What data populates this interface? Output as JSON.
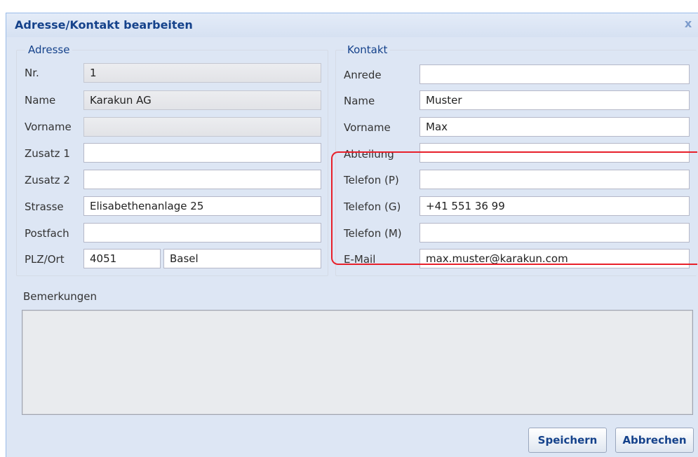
{
  "dialog": {
    "title": "Adresse/Kontakt bearbeiten",
    "close_glyph": "x"
  },
  "adresse": {
    "legend": "Adresse",
    "fields": {
      "nr": {
        "label": "Nr.",
        "value": "1"
      },
      "name": {
        "label": "Name",
        "value": "Karakun AG"
      },
      "vorname": {
        "label": "Vorname",
        "value": ""
      },
      "zusatz1": {
        "label": "Zusatz 1",
        "value": ""
      },
      "zusatz2": {
        "label": "Zusatz 2",
        "value": ""
      },
      "strasse": {
        "label": "Strasse",
        "value": "Elisabethenanlage 25"
      },
      "postfach": {
        "label": "Postfach",
        "value": ""
      },
      "plzort": {
        "label": "PLZ/Ort",
        "plz": "4051",
        "ort": "Basel"
      }
    }
  },
  "kontakt": {
    "legend": "Kontakt",
    "fields": {
      "anrede": {
        "label": "Anrede",
        "value": ""
      },
      "name": {
        "label": "Name",
        "value": "Muster"
      },
      "vorname": {
        "label": "Vorname",
        "value": "Max"
      },
      "abteilung": {
        "label": "Abteilung",
        "value": ""
      },
      "telefon_p": {
        "label": "Telefon (P)",
        "value": ""
      },
      "telefon_g": {
        "label": "Telefon (G)",
        "value": "+41 551 36 99"
      },
      "telefon_m": {
        "label": "Telefon (M)",
        "value": ""
      },
      "email": {
        "label": "E-Mail",
        "value": "max.muster@karakun.com"
      }
    }
  },
  "bemerkungen": {
    "label": "Bemerkungen",
    "value": ""
  },
  "buttons": {
    "save": "Speichern",
    "cancel": "Abbrechen"
  },
  "colors": {
    "highlight": "#e8202a",
    "title": "#15428b"
  }
}
